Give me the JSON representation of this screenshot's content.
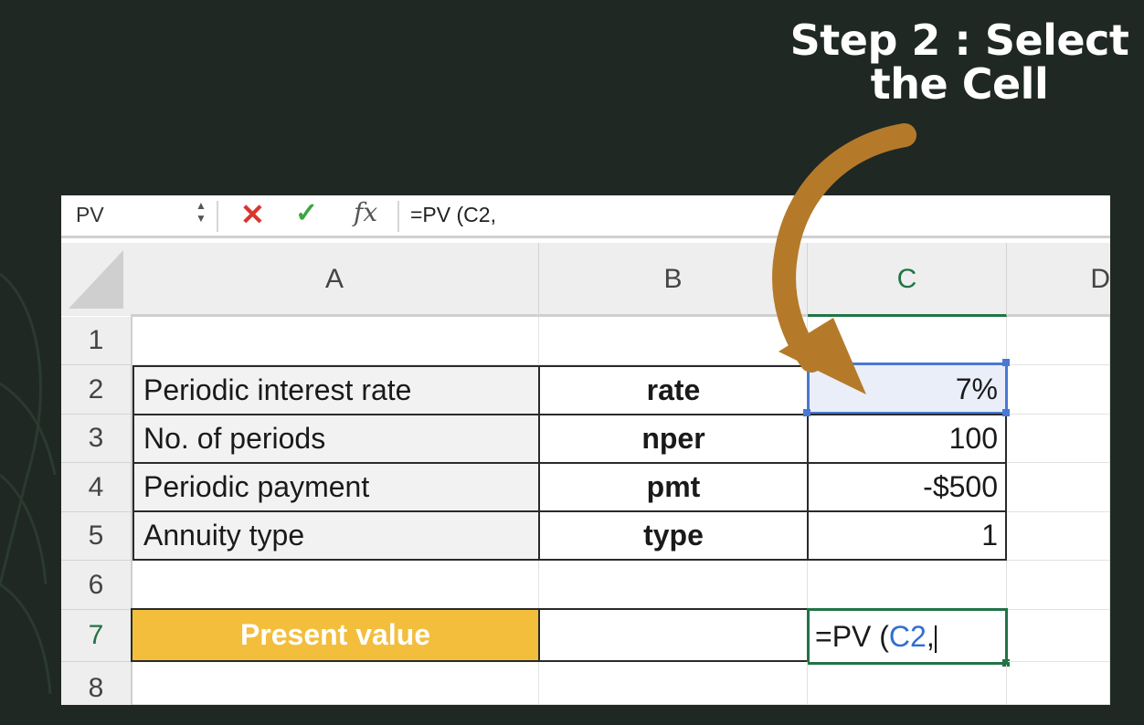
{
  "caption": {
    "line1": "Step 2  : Select",
    "line2": "the Cell"
  },
  "formula_bar": {
    "name_box": "PV",
    "cancel_icon": "✕",
    "enter_icon": "✓",
    "function_icon": "fx",
    "formula": "=PV (C2,"
  },
  "columns": [
    "A",
    "B",
    "C",
    "D"
  ],
  "rows": [
    "1",
    "2",
    "3",
    "4",
    "5",
    "6",
    "7",
    "8"
  ],
  "table": [
    {
      "label": "Periodic interest rate",
      "param": "rate",
      "value": "7%"
    },
    {
      "label": "No. of periods",
      "param": "nper",
      "value": "100"
    },
    {
      "label": "Periodic payment",
      "param": "pmt",
      "value": "-$500"
    },
    {
      "label": "Annuity type",
      "param": "type",
      "value": "1"
    }
  ],
  "result": {
    "label": "Present value",
    "edit_prefix": "=PV (",
    "edit_ref": "C2",
    "edit_suffix": ","
  },
  "colors": {
    "background": "#1f2823",
    "arrow": "#b47a2a",
    "present_value_fill": "#f2be3c",
    "selection": "#4a78d4",
    "excel_green": "#217346"
  }
}
